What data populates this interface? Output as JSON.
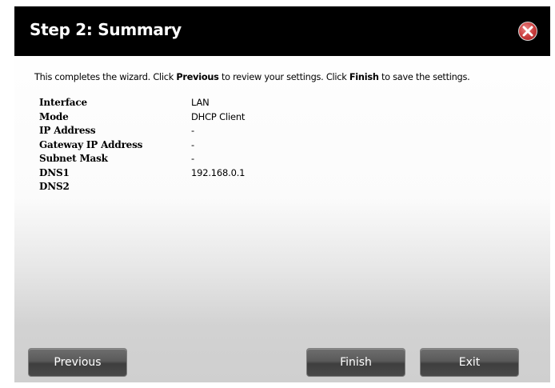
{
  "dialog": {
    "title": "Step 2: Summary",
    "close_icon": "close-icon"
  },
  "intro": {
    "part1": "This completes the wizard. Click ",
    "previous_word": "Previous",
    "part2": " to review your settings. Click ",
    "finish_word": "Finish",
    "part3": " to save the settings."
  },
  "summary": [
    {
      "label": "Interface",
      "value": "LAN"
    },
    {
      "label": "Mode",
      "value": "DHCP Client"
    },
    {
      "label": "IP Address",
      "value": "-"
    },
    {
      "label": "Gateway IP Address",
      "value": "-"
    },
    {
      "label": "Subnet Mask",
      "value": "-"
    },
    {
      "label": "DNS1",
      "value": "192.168.0.1"
    },
    {
      "label": "DNS2",
      "value": ""
    }
  ],
  "buttons": {
    "previous": "Previous",
    "finish": "Finish",
    "exit": "Exit"
  },
  "colors": {
    "titlebar": "#000000",
    "close_button": "#c83a3a",
    "button": "#4a4a4a"
  }
}
